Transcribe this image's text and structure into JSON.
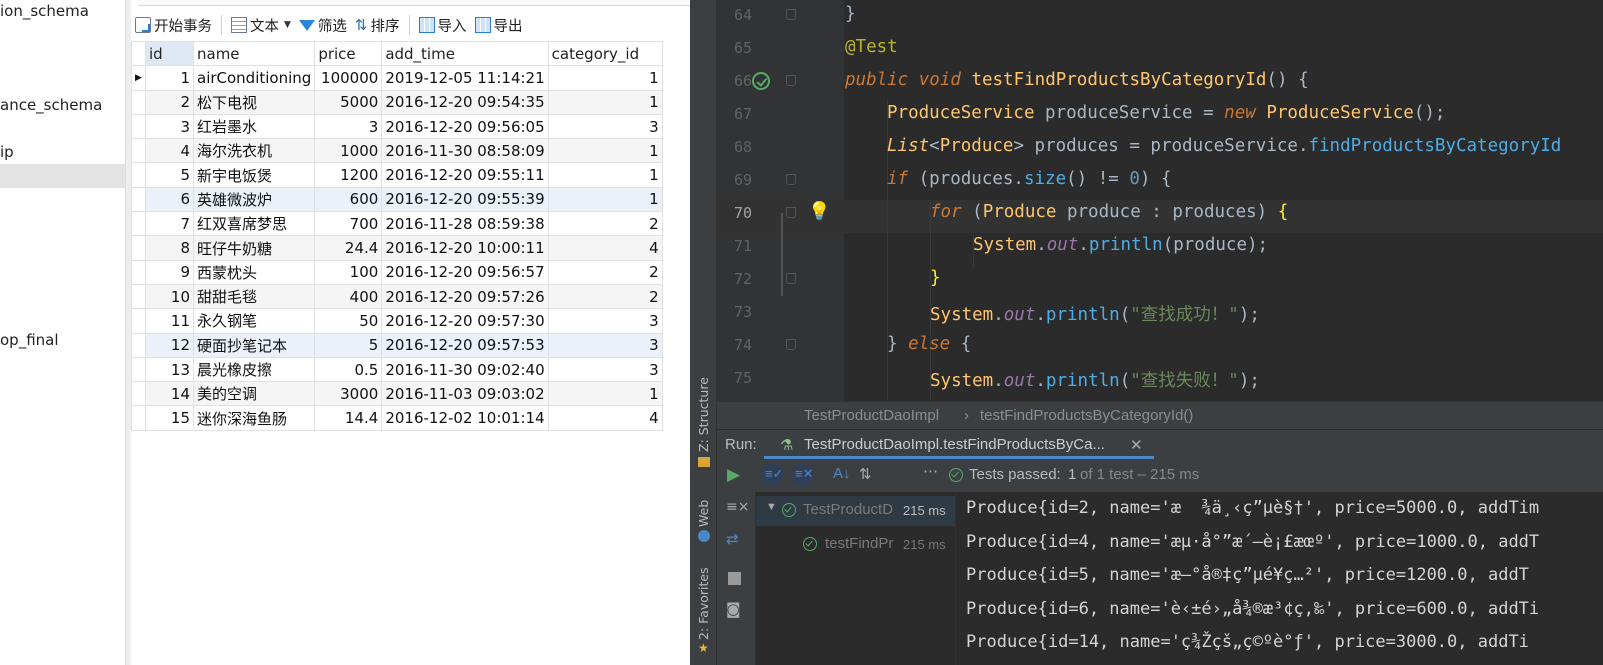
{
  "db_tree": {
    "items": [
      "ion_schema",
      "ance_schema",
      "ip",
      "op_final"
    ]
  },
  "grid_toolbar": {
    "begin_txn": "开始事务",
    "text": "文本",
    "filter": "筛选",
    "sort": "排序",
    "import": "导入",
    "export": "导出"
  },
  "table": {
    "columns": [
      "id",
      "name",
      "price",
      "add_time",
      "category_id"
    ],
    "rows": [
      [
        "1",
        "airConditioning",
        "100000",
        "2019-12-05 11:14:21",
        "1"
      ],
      [
        "2",
        "松下电视",
        "5000",
        "2016-12-20 09:54:35",
        "1"
      ],
      [
        "3",
        "红岩墨水",
        "3",
        "2016-12-20 09:56:05",
        "3"
      ],
      [
        "4",
        "海尔洗衣机",
        "1000",
        "2016-11-30 08:58:09",
        "1"
      ],
      [
        "5",
        "新宇电饭煲",
        "1200",
        "2016-12-20 09:55:11",
        "1"
      ],
      [
        "6",
        "英雄微波炉",
        "600",
        "2016-12-20 09:55:39",
        "1"
      ],
      [
        "7",
        "红双喜席梦思",
        "700",
        "2016-11-28 08:59:38",
        "2"
      ],
      [
        "8",
        "旺仔牛奶糖",
        "24.4",
        "2016-12-20 10:00:11",
        "4"
      ],
      [
        "9",
        "西蒙枕头",
        "100",
        "2016-12-20 09:56:57",
        "2"
      ],
      [
        "10",
        "甜甜毛毯",
        "400",
        "2016-12-20 09:57:26",
        "2"
      ],
      [
        "11",
        "永久钢笔",
        "50",
        "2016-12-20 09:57:30",
        "3"
      ],
      [
        "12",
        "硬面抄笔记本",
        "5",
        "2016-12-20 09:57:53",
        "3"
      ],
      [
        "13",
        "晨光橡皮擦",
        "0.5",
        "2016-11-30 09:02:40",
        "3"
      ],
      [
        "14",
        "美的空调",
        "3000",
        "2016-11-03 09:03:02",
        "1"
      ],
      [
        "15",
        "迷你深海鱼肠",
        "14.4",
        "2016-12-02 10:01:14",
        "4"
      ]
    ]
  },
  "editor": {
    "line_numbers": [
      "64",
      "65",
      "66",
      "67",
      "68",
      "69",
      "70",
      "71",
      "72",
      "73",
      "74",
      "75"
    ],
    "current_line": "70"
  },
  "breadcrumb": {
    "class": "TestProductDaoImpl",
    "method": "testFindProductsByCategoryId()"
  },
  "run_panel": {
    "label": "Run:",
    "tab_title": "TestProductDaoImpl.testFindProductsByCa...",
    "tests_passed": "Tests passed:",
    "count": "1",
    "of_total": "of 1 test – 215 ms",
    "tree": [
      {
        "name": "TestProductD",
        "time": "215 ms"
      },
      {
        "name": "testFindPr",
        "time": "215 ms"
      }
    ]
  },
  "console": {
    "lines": [
      "Produce{id=2, name='æ  ¾ä¸‹ç”µè§†', price=5000.0, addTim",
      "Produce{id=4, name='æµ·å°”æ´—è¡£æœº', price=1000.0, addT",
      "Produce{id=5, name='æ–°å®‡ç”µé¥­ç…²', price=1200.0, addT",
      "Produce{id=6, name='è‹±é›„å¾®æ³¢ç‚‰', price=600.0, addTi",
      "Produce{id=14, name='ç¾Žçš„ç©ºè°ƒ', price=3000.0, addTi"
    ]
  },
  "side_tools": {
    "structure": "Z: Structure",
    "web": "Web",
    "favorites": "2: Favorites"
  },
  "colors": {
    "ide_bg": "#2b2b2b",
    "keyword": "#cc7832",
    "string": "#6a8759",
    "method": "#ffc66d",
    "accent": "#4a88c7",
    "pass_green": "#59a869"
  }
}
